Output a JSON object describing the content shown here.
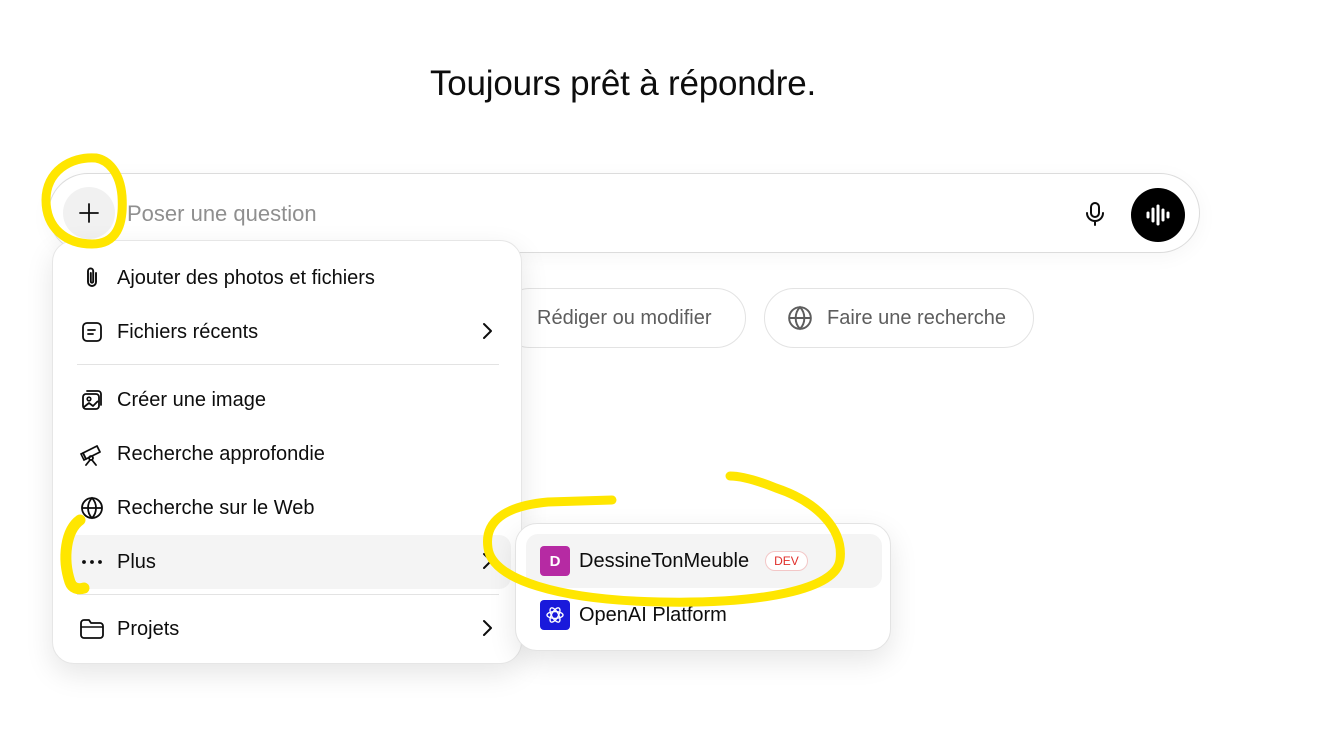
{
  "headline": "Toujours prêt à répondre.",
  "composer": {
    "placeholder": "Poser une question",
    "value": "",
    "plus_icon": "plus-icon",
    "mic_icon": "microphone-icon",
    "voice_icon": "voice-waveform-icon"
  },
  "chips": [
    {
      "label": "Rédiger ou modifier"
    },
    {
      "label": "Faire une recherche",
      "icon": "globe-icon"
    }
  ],
  "menu": {
    "items": [
      {
        "label": "Ajouter des photos et fichiers",
        "icon": "paperclip-icon"
      },
      {
        "label": "Fichiers récents",
        "icon": "file-icon",
        "has_submenu": true
      },
      {
        "label": "Créer une image",
        "icon": "image-create-icon"
      },
      {
        "label": "Recherche approfondie",
        "icon": "telescope-icon"
      },
      {
        "label": "Recherche sur le Web",
        "icon": "globe-icon"
      },
      {
        "label": "Plus",
        "icon": "more-dots-icon",
        "has_submenu": true,
        "active": true
      },
      {
        "label": "Projets",
        "icon": "folder-icon",
        "has_submenu": true
      }
    ]
  },
  "submenu": {
    "items": [
      {
        "label": "DessineTonMeuble",
        "icon_letter": "D",
        "badge": "DEV",
        "icon_color": "#b62aa3"
      },
      {
        "label": "OpenAI Platform",
        "icon": "openai-logo-icon",
        "icon_color": "#1a1adb"
      }
    ]
  },
  "colors": {
    "annotation": "#ffe600",
    "dev_badge": "#e02e2a"
  }
}
